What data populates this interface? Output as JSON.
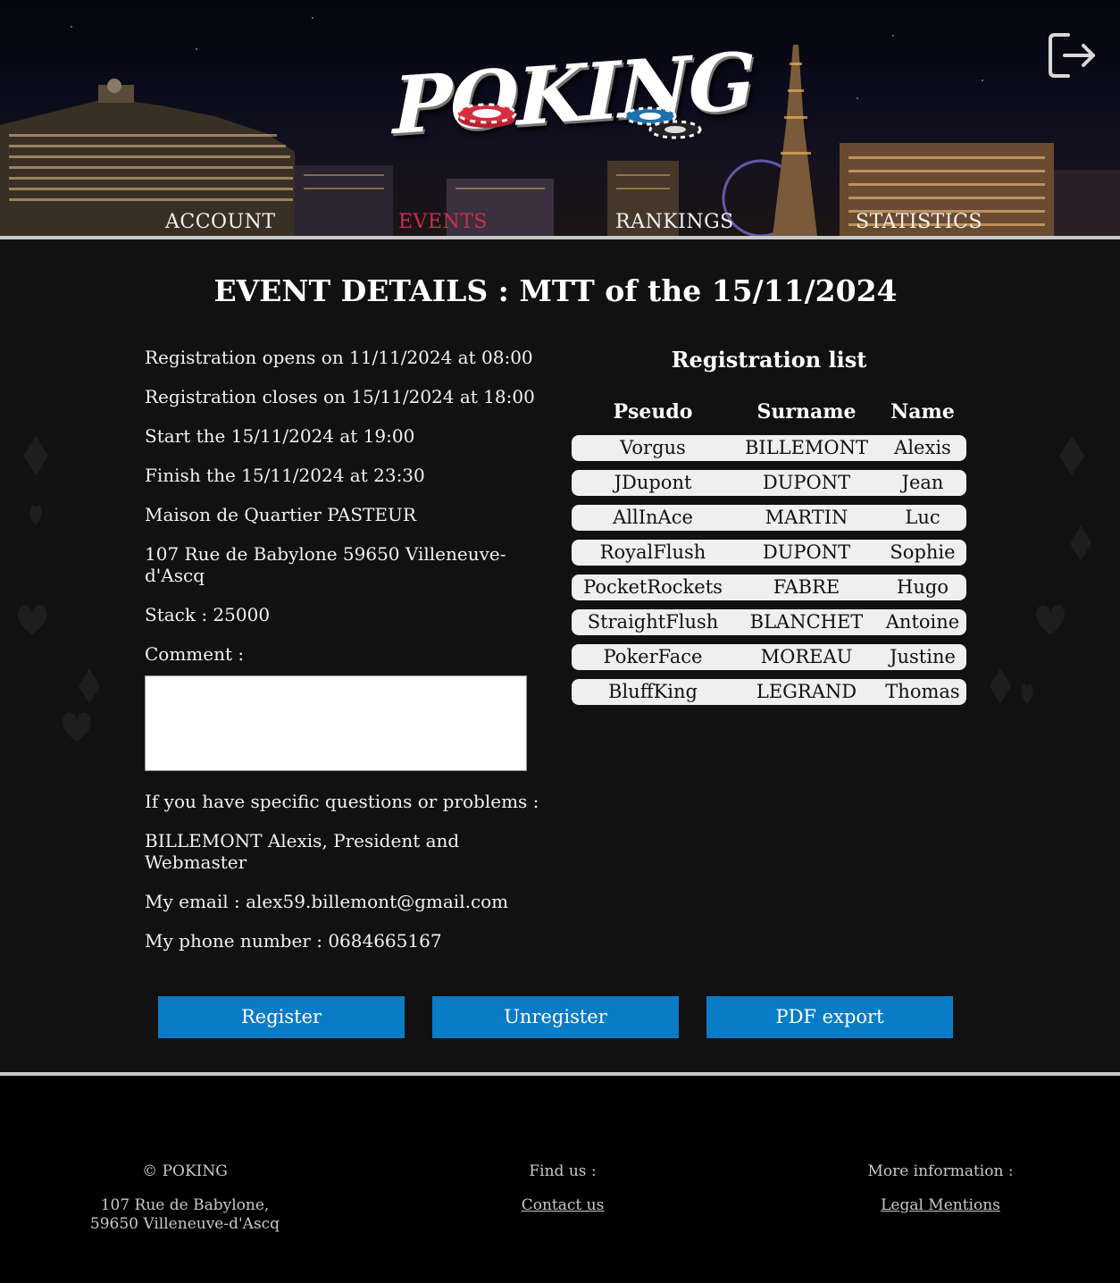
{
  "header": {
    "logo_text": "POKING",
    "nav": [
      {
        "label": "ACCOUNT",
        "active": false
      },
      {
        "label": "EVENTS",
        "active": true
      },
      {
        "label": "RANKINGS",
        "active": false
      },
      {
        "label": "STATISTICS",
        "active": false
      }
    ],
    "logout_icon": "logout-icon"
  },
  "main": {
    "title": "EVENT DETAILS : MTT of the 15/11/2024",
    "details": {
      "reg_opens": "Registration opens on 11/11/2024 at 08:00",
      "reg_closes": "Registration closes on 15/11/2024 at 18:00",
      "start": "Start the 15/11/2024 at 19:00",
      "finish": "Finish the 15/11/2024 at 23:30",
      "venue": "Maison de Quartier PASTEUR",
      "address": "107 Rue de Babylone 59650 Villeneuve-d'Ascq",
      "stack": "Stack : 25000",
      "comment_label": "Comment :",
      "comment_value": "",
      "questions": "If you have specific questions or problems :",
      "contact_name": "BILLEMONT Alexis, President and Webmaster",
      "email": "My email : alex59.billemont@gmail.com",
      "phone": "My phone number : 0684665167"
    },
    "registration": {
      "title": "Registration list",
      "headers": {
        "pseudo": "Pseudo",
        "surname": "Surname",
        "name": "Name"
      },
      "rows": [
        {
          "pseudo": "Vorgus",
          "surname": "BILLEMONT",
          "name": "Alexis"
        },
        {
          "pseudo": "JDupont",
          "surname": "DUPONT",
          "name": "Jean"
        },
        {
          "pseudo": "AllInAce",
          "surname": "MARTIN",
          "name": "Luc"
        },
        {
          "pseudo": "RoyalFlush",
          "surname": "DUPONT",
          "name": "Sophie"
        },
        {
          "pseudo": "PocketRockets",
          "surname": "FABRE",
          "name": "Hugo"
        },
        {
          "pseudo": "StraightFlush",
          "surname": "BLANCHET",
          "name": "Antoine"
        },
        {
          "pseudo": "PokerFace",
          "surname": "MOREAU",
          "name": "Justine"
        },
        {
          "pseudo": "BluffKing",
          "surname": "LEGRAND",
          "name": "Thomas"
        }
      ]
    },
    "buttons": {
      "register": "Register",
      "unregister": "Unregister",
      "pdf_export": "PDF export"
    }
  },
  "footer": {
    "copyright": "© POKING",
    "address_line1": "107 Rue de Babylone,",
    "address_line2": "59650 Villeneuve-d'Ascq",
    "find_us": "Find us :",
    "contact_link": "Contact us",
    "more_info": "More information :",
    "legal_link": "Legal Mentions"
  },
  "colors": {
    "accent_nav_active": "#c9304f",
    "button_blue": "#0a7cc6",
    "background": "#111111",
    "footer_bg": "#000000"
  }
}
